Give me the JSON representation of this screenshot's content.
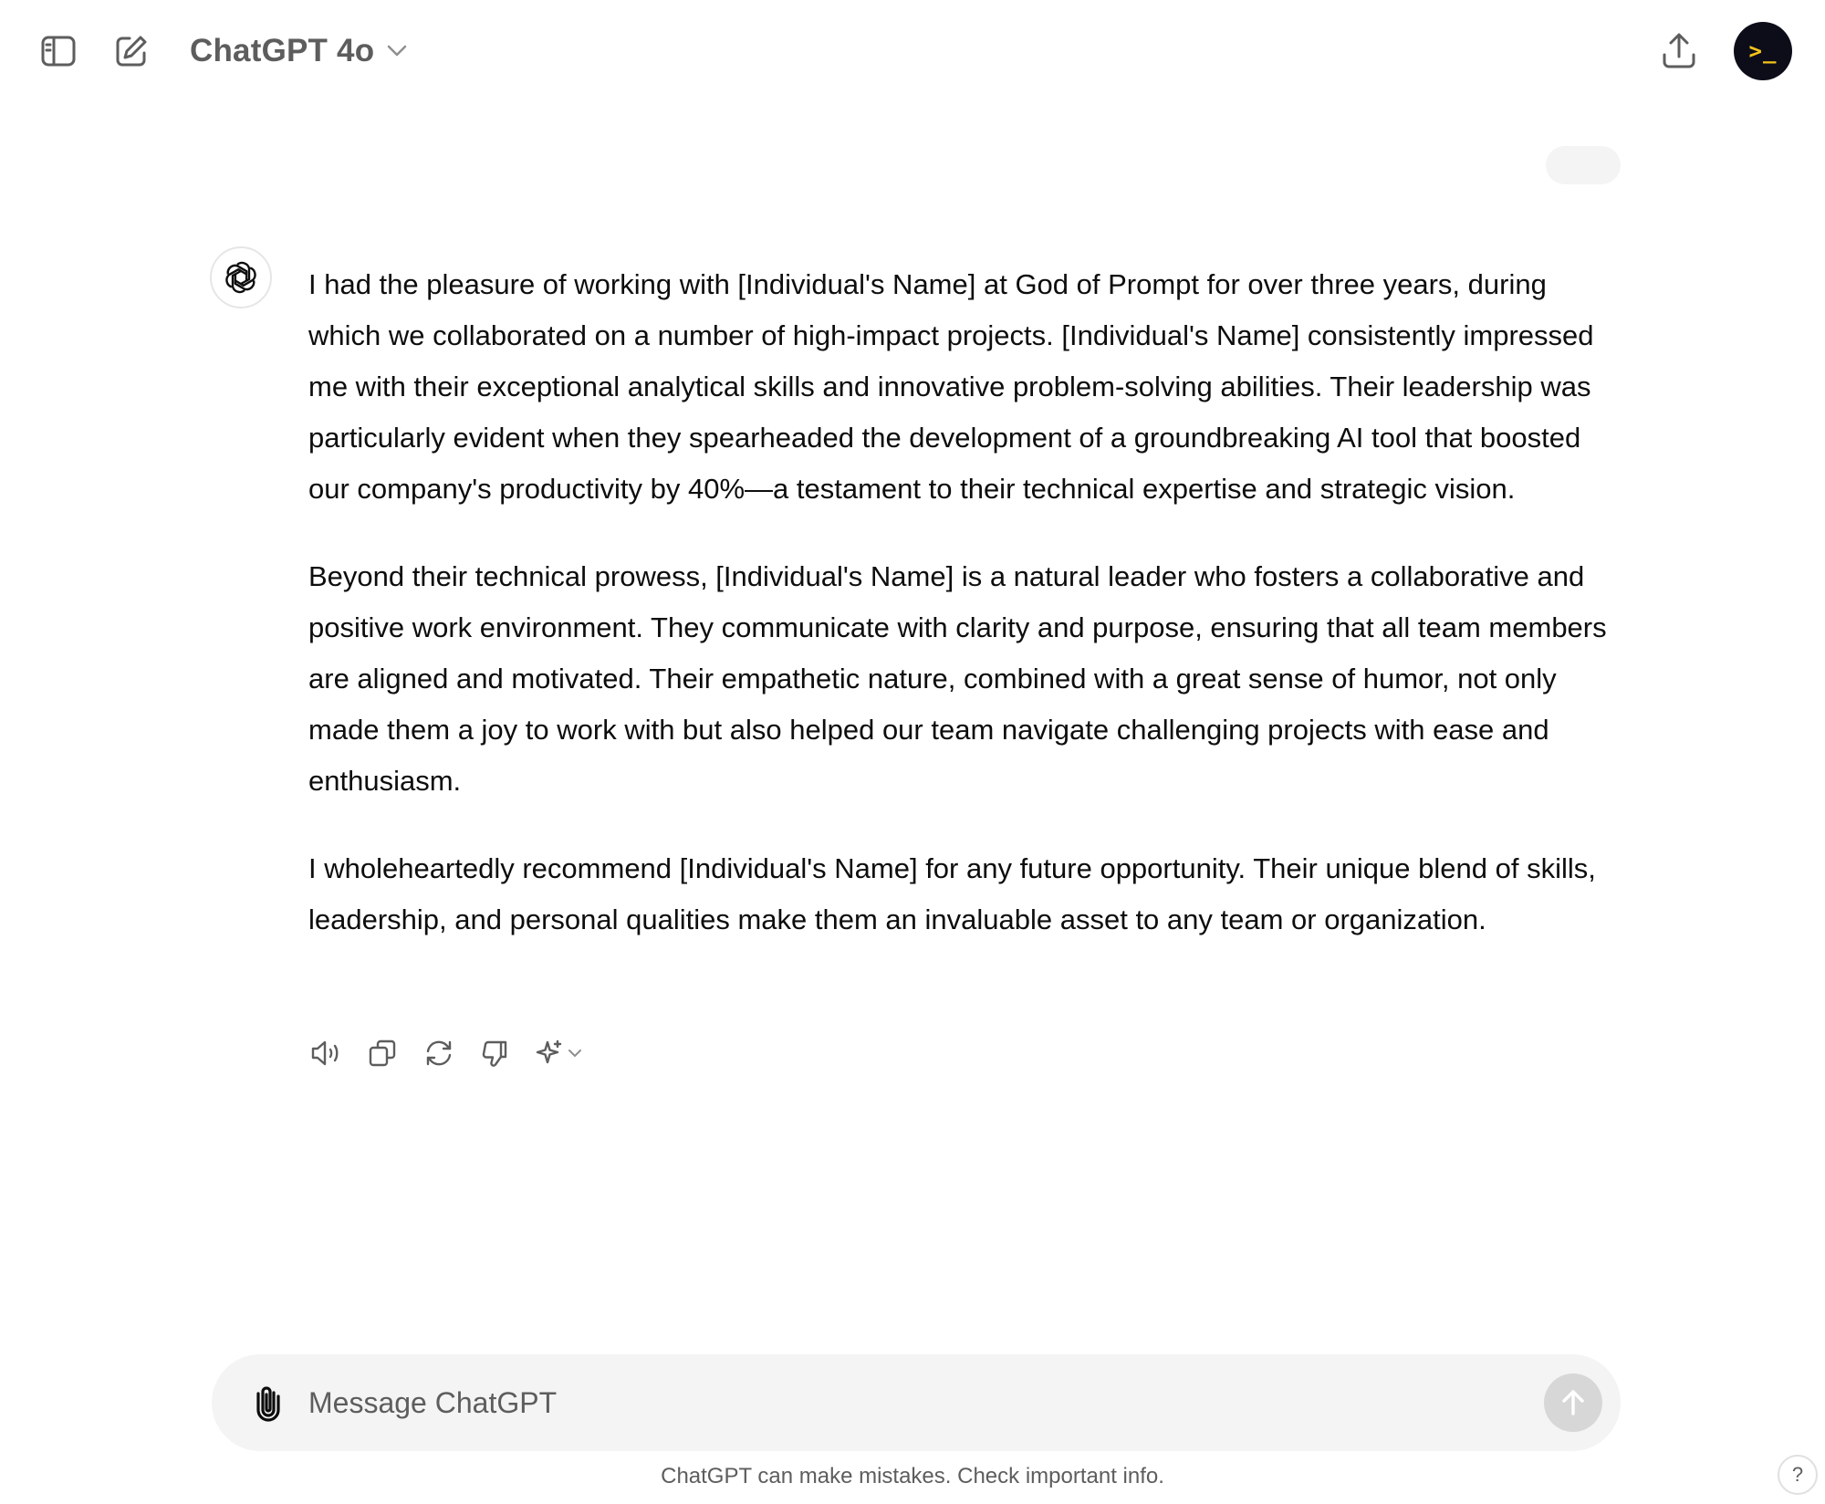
{
  "header": {
    "model_name": "ChatGPT 4o",
    "sidebar_toggle_icon": "sidebar-toggle-icon",
    "new_chat_icon": "new-chat-icon",
    "share_icon": "share-icon",
    "avatar_glyph": ">_"
  },
  "conversation": {
    "assistant_message": {
      "paragraphs": [
        "I had the pleasure of working with [Individual's Name] at God of Prompt for over three years, during which we collaborated on a number of high-impact projects. [Individual's Name] consistently impressed me with their exceptional analytical skills and innovative problem-solving abilities. Their leadership was particularly evident when they spearheaded the development of a groundbreaking AI tool that boosted our company's productivity by 40%—a testament to their technical expertise and strategic vision.",
        "Beyond their technical prowess, [Individual's Name] is a natural leader who fosters a collaborative and positive work environment. They communicate with clarity and purpose, ensuring that all team members are aligned and motivated. Their empathetic nature, combined with a great sense of humor, not only made them a joy to work with but also helped our team navigate challenging projects with ease and enthusiasm.",
        "I wholeheartedly recommend [Individual's Name] for any future opportunity. Their unique blend of skills, leadership, and personal qualities make them an invaluable asset to any team or organization."
      ],
      "actions": [
        "read-aloud-icon",
        "copy-icon",
        "regenerate-icon",
        "thumbs-down-icon",
        "sparkle-icon"
      ]
    }
  },
  "composer": {
    "placeholder": "Message ChatGPT",
    "value": ""
  },
  "footer": {
    "disclaimer": "ChatGPT can make mistakes. Check important info.",
    "help_label": "?"
  },
  "colors": {
    "text": "#0d0d0d",
    "muted": "#5d5d5d",
    "composer_bg": "#f4f4f4",
    "send_disabled": "#d7d7d7",
    "avatar_bg": "#0d0d1a",
    "avatar_accent": "#f5c518"
  }
}
